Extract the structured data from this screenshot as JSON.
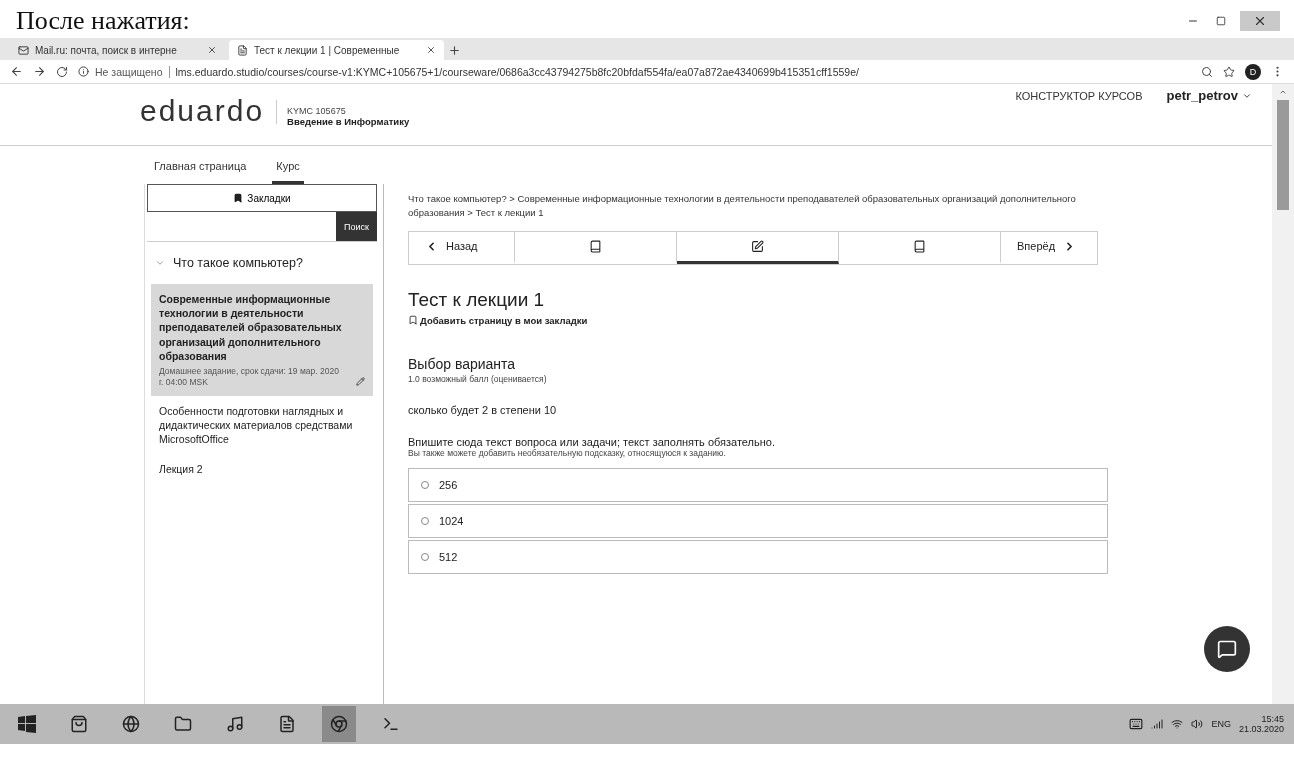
{
  "caption": "После нажатия:",
  "browser": {
    "tabs": [
      {
        "title": "Mail.ru: почта, поиск в интерне",
        "selected": false
      },
      {
        "title": "Тест к лекции 1 | Современные",
        "selected": true
      }
    ],
    "security": "Не защищено",
    "url": "lms.eduardo.studio/courses/course-v1:KYMC+105675+1/courseware/0686a3cc43794275b8fc20bfdaf554fa/ea07a872ae4340699b415351cff1559e/",
    "profile_initial": "D"
  },
  "header": {
    "logo": "eduardo",
    "course_code": "KYMC 105675",
    "course_title": "Введение в Информатику",
    "studio_link": "КОНСТРУКТОР КУРСОВ",
    "username": "petr_petrov"
  },
  "course_tabs": [
    {
      "label": "Главная страница",
      "selected": false
    },
    {
      "label": "Курс",
      "selected": true
    }
  ],
  "sidebar": {
    "bookmarks_button": "Закладки",
    "search_button": "Поиск",
    "chapter": {
      "title": "Что такое компьютер?",
      "expanded": true
    },
    "sections": [
      {
        "title": "Современные информационные технологии в деятельности преподавателей образовательных организаций дополнительного образования",
        "subtitle": "Домашнее задание, срок сдачи: 19 мар. 2020 г. 04:00 MSK",
        "selected": true
      },
      {
        "title": "Особенности подготовки наглядных и дидактических материалов средствами MicrosoftOffice",
        "selected": false
      },
      {
        "title": "Лекция 2",
        "selected": false
      }
    ]
  },
  "main": {
    "breadcrumb": "Что такое компьютер? > Современные информационные технологии в деятельности преподавателей образовательных организаций дополнительного образования > Тест к лекции 1",
    "prev": "Назад",
    "next": "Вперёд",
    "units": [
      {
        "kind": "book",
        "selected": false
      },
      {
        "kind": "edit",
        "selected": true
      },
      {
        "kind": "book",
        "selected": false
      }
    ],
    "unit_title": "Тест к лекции 1",
    "bookmark_link": "Добавить страницу в мои закладки",
    "problem": {
      "title": "Выбор варианта",
      "points": "1.0 возможный балл (оценивается)",
      "question": "сколько будет 2 в степени 10",
      "prompt": "Впишите сюда текст вопроса или задачи; текст заполнять обязательно.",
      "hint": "Вы также можете добавить необязательную подсказку, относящуюся к заданию.",
      "options": [
        {
          "label": "256",
          "selected": false
        },
        {
          "label": "1024",
          "selected": false
        },
        {
          "label": "512",
          "selected": false
        }
      ]
    }
  },
  "taskbar": {
    "language": "ENG",
    "time": "15:45",
    "date": "21.03.2020"
  }
}
